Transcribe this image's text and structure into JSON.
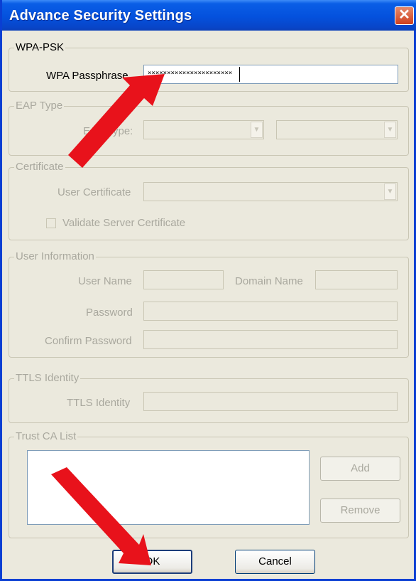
{
  "window": {
    "title": "Advance Security Settings",
    "close_icon": "close-icon"
  },
  "wpa_psk": {
    "legend": "WPA-PSK",
    "passphrase_label": "WPA Passphrase",
    "passphrase_value": "××××××××××××××××××××××"
  },
  "eap_type": {
    "legend": "EAP Type",
    "label": "EAP Type:"
  },
  "certificate": {
    "legend": "Certificate",
    "user_certificate_label": "User Certificate",
    "validate_label": "Validate Server Certificate",
    "validate_checked": false
  },
  "user_information": {
    "legend": "User Information",
    "user_name_label": "User Name",
    "domain_name_label": "Domain Name",
    "password_label": "Password",
    "confirm_password_label": "Confirm Password"
  },
  "ttls": {
    "legend": "TTLS Identity",
    "label": "TTLS Identity"
  },
  "trust_ca": {
    "legend": "Trust CA List",
    "add_label": "Add",
    "remove_label": "Remove"
  },
  "footer": {
    "ok_label": "OK",
    "cancel_label": "Cancel"
  },
  "annotation_color": "#e8121b"
}
